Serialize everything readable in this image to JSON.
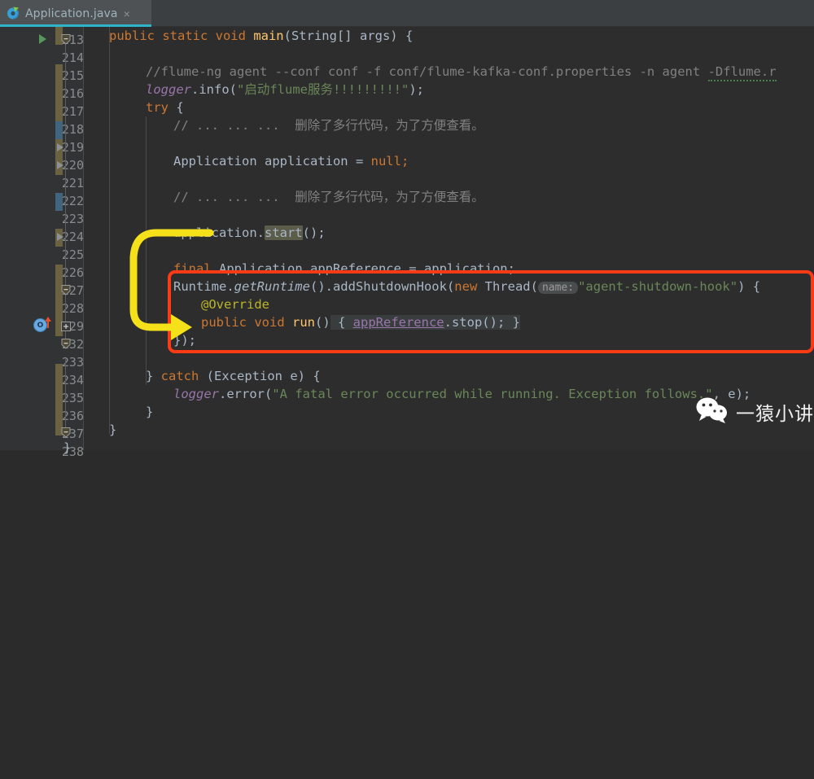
{
  "tab": {
    "label": "Application.java",
    "close": "×",
    "icon": "java-class-icon"
  },
  "editor": {
    "first_line": 213,
    "lines": [
      {
        "n": "213",
        "marker": "run-triangle",
        "fold": "fold-collapse",
        "vcs": "mod"
      },
      {
        "n": "214",
        "vcs": ""
      },
      {
        "n": "215",
        "vcs": "mod"
      },
      {
        "n": "216",
        "vcs": "mod"
      },
      {
        "n": "217",
        "vcs": "mod"
      },
      {
        "n": "218",
        "vcs": "add"
      },
      {
        "n": "219",
        "marker": "nav-triangle",
        "vcs": "mod"
      },
      {
        "n": "220",
        "marker": "nav-triangle",
        "vcs": "mod"
      },
      {
        "n": "221",
        "vcs": ""
      },
      {
        "n": "222",
        "vcs": "add"
      },
      {
        "n": "223",
        "vcs": ""
      },
      {
        "n": "224",
        "marker": "nav-triangle",
        "vcs": "mod"
      },
      {
        "n": "225",
        "vcs": ""
      },
      {
        "n": "226",
        "vcs": "mod"
      },
      {
        "n": "227",
        "fold": "fold-collapse",
        "vcs": "mod"
      },
      {
        "n": "228",
        "vcs": "mod"
      },
      {
        "n": "229",
        "marker": "override-icon",
        "fold": "fold-expand",
        "vcs": "mod"
      },
      {
        "n": "232",
        "fold": "fold-collapse",
        "vcs": "mod"
      },
      {
        "n": "233",
        "vcs": ""
      },
      {
        "n": "234",
        "vcs": "mod"
      },
      {
        "n": "235",
        "vcs": "mod"
      },
      {
        "n": "236",
        "vcs": "mod"
      },
      {
        "n": "237",
        "fold": "fold-collapse",
        "vcs": "mod"
      },
      {
        "n": "238",
        "vcs": ""
      }
    ],
    "code": {
      "l213_public": "public static void ",
      "l213_main": "main",
      "l213_sig": "(String[] args) {",
      "l215_comment": "//flume-ng agent --conf conf -f conf/flume-kafka-conf.properties -n agent ",
      "l215_comment_sq": "-Dflume.r",
      "l216_logger": "logger",
      "l216_info": ".info(",
      "l216_str": "\"启动flume服务!!!!!!!!!\"",
      "l216_end": ");",
      "l217_try": "try",
      "l217_brace": " {",
      "l218_comment": "// ... ... ...  删除了多行代码，为了方便查看。",
      "l220_decl": "Application application = ",
      "l220_null": "null;",
      "l222_comment": "// ... ... ...  删除了多行代码，为了方便查看。",
      "l224_app": "application.",
      "l224_start": "start",
      "l224_end": "();",
      "l226_final": "final",
      "l226_rest": " Application appReference = application;",
      "l227_runtime": "Runtime.",
      "l227_getruntime": "getRuntime",
      "l227_mid": "().addShutdownHook(",
      "l227_new": "new",
      "l227_thread": " Thread(",
      "l227_hint": "name:",
      "l227_str": "\"agent-shutdown-hook\"",
      "l227_tail": ") {",
      "l228_override": "@Override",
      "l229_public": "public void ",
      "l229_run": "run",
      "l229_parens": "()",
      "l229_open": " { ",
      "l229_ref": "appReference",
      "l229_stop": ".stop(); ",
      "l229_close": "}",
      "l232_close": "});",
      "l234_catch_a": "} ",
      "l234_catch": "catch",
      "l234_catch_b": " (Exception e) {",
      "l235_logger": "logger",
      "l235_error": ".error(",
      "l235_str": "\"A fatal error occurred while running. Exception follows.\"",
      "l235_comma": ", e);",
      "l236_close": "}",
      "l237_close": "}",
      "l238_close": "}"
    }
  },
  "annotations": {
    "red_box_name": "shutdown-hook-highlight",
    "red_box_color": "#fb3b16",
    "arrow_name": "yellow-pointer-arrow",
    "arrow_color": "#f5e119"
  },
  "watermark": {
    "text": "一猿小讲",
    "icon": "wechat-icon"
  }
}
